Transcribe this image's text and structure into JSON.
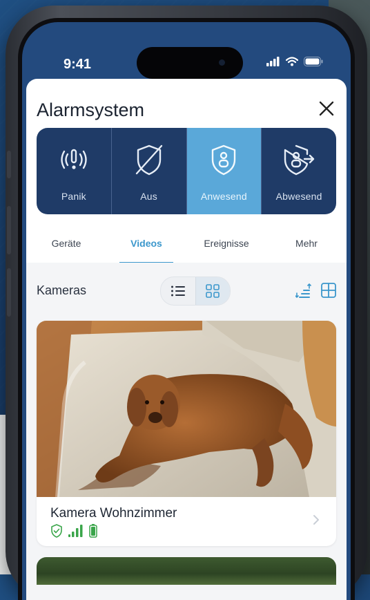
{
  "status_bar": {
    "time": "9:41"
  },
  "sheet": {
    "title": "Alarmsystem"
  },
  "modes": [
    {
      "label": "Panik",
      "icon": "panic-icon",
      "active": false
    },
    {
      "label": "Aus",
      "icon": "shield-off-icon",
      "active": false
    },
    {
      "label": "Anwesend",
      "icon": "shield-home-icon",
      "active": true
    },
    {
      "label": "Abwesend",
      "icon": "shield-away-icon",
      "active": false
    }
  ],
  "tabs": [
    {
      "label": "Geräte",
      "active": false
    },
    {
      "label": "Videos",
      "active": true
    },
    {
      "label": "Ereignisse",
      "active": false
    },
    {
      "label": "Mehr",
      "active": false
    }
  ],
  "content": {
    "section_label": "Kameras",
    "view_mode": "grid"
  },
  "cameras": [
    {
      "name": "Kamera Wohnzimmer",
      "status_icons": [
        "shield-check-icon",
        "signal-icon",
        "battery-icon"
      ],
      "status_color": "#3aa54a"
    }
  ],
  "colors": {
    "brand_dark": "#1f3b67",
    "accent": "#5aa8d9",
    "tab_active": "#3b97cc",
    "ok_green": "#3aa54a"
  }
}
